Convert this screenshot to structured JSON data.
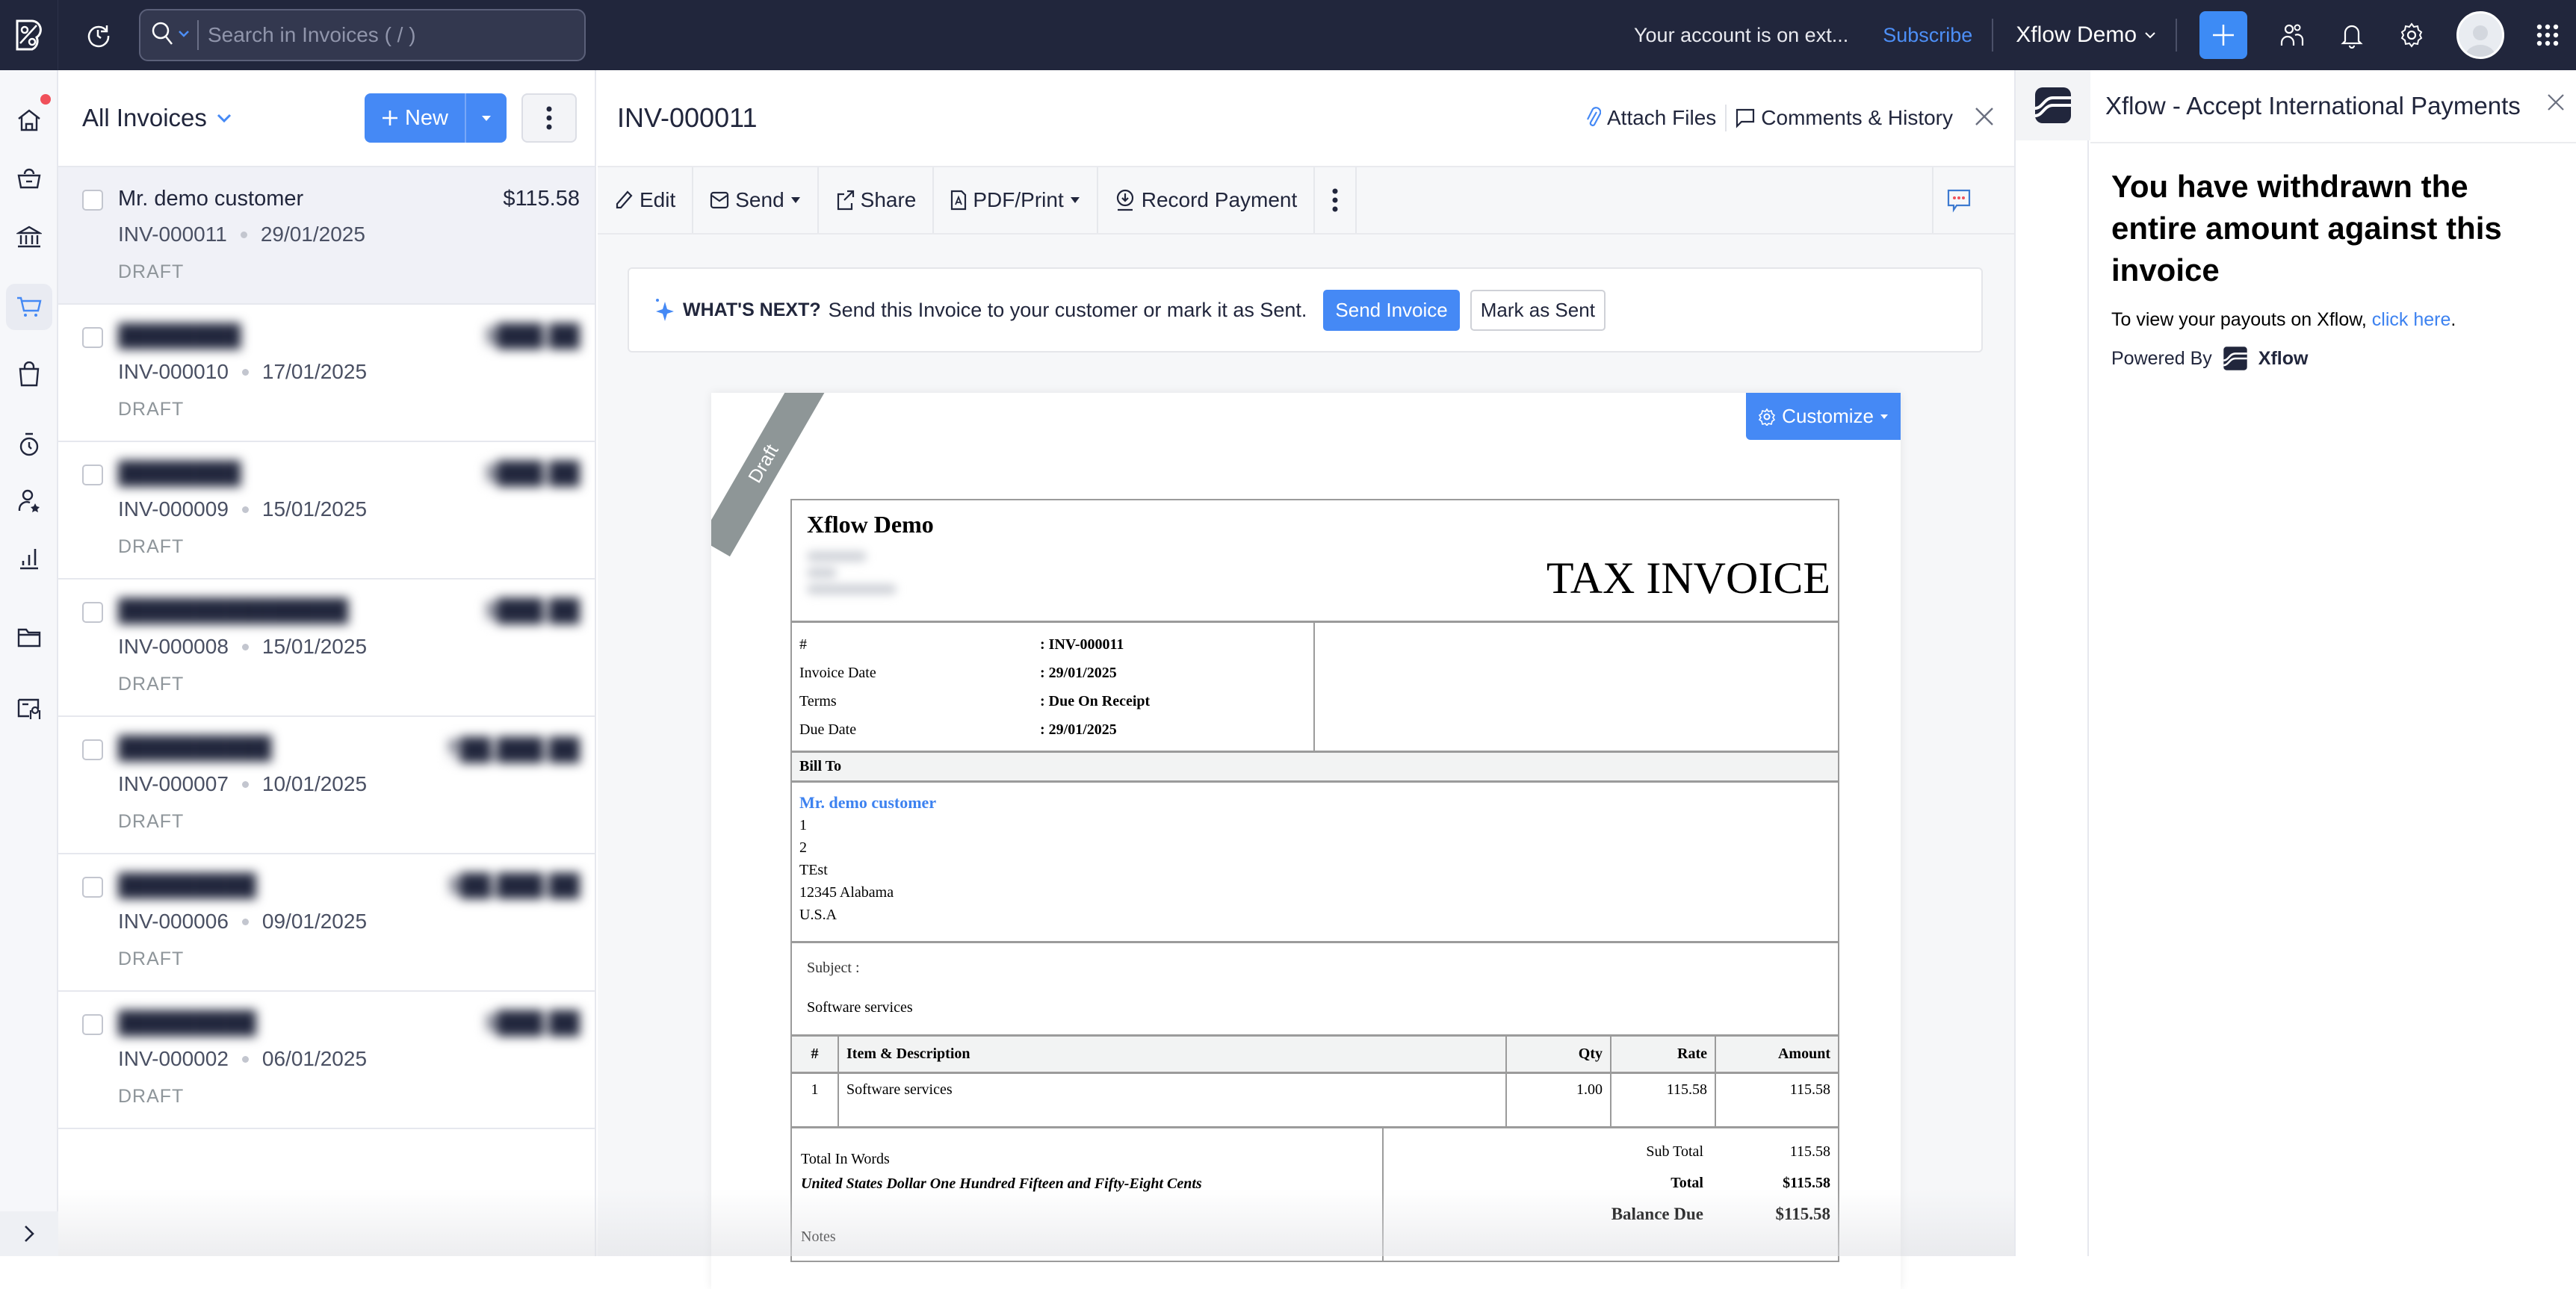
{
  "topbar": {
    "search_placeholder": "Search in Invoices ( / )",
    "account_notice": "Your account is on ext...",
    "subscribe_label": "Subscribe",
    "org_name": "Xflow Demo"
  },
  "sidebar": {
    "items": [
      "home-icon",
      "items-basket-icon",
      "banking-icon",
      "sales-cart-icon",
      "purchases-bag-icon",
      "time-tracking-icon",
      "accountant-icon",
      "reports-icon",
      "documents-folder-icon",
      "more-apps-icon"
    ],
    "active": "sales-cart-icon"
  },
  "list": {
    "title": "All Invoices",
    "new_label": "New",
    "rows": [
      {
        "name": "Mr. demo customer",
        "amount": "$115.58",
        "number": "INV-000011",
        "date": "29/01/2025",
        "status": "DRAFT",
        "blurred": false,
        "selected": true
      },
      {
        "name": "████████",
        "amount": "$███.██",
        "number": "INV-000010",
        "date": "17/01/2025",
        "status": "DRAFT",
        "blurred": true
      },
      {
        "name": "████████",
        "amount": "$███.██",
        "number": "INV-000009",
        "date": "15/01/2025",
        "status": "DRAFT",
        "blurred": true
      },
      {
        "name": "███████████████",
        "amount": "$███.██",
        "number": "INV-000008",
        "date": "15/01/2025",
        "status": "DRAFT",
        "blurred": true
      },
      {
        "name": "██████████",
        "amount": "₹██,███.██",
        "number": "INV-000007",
        "date": "10/01/2025",
        "status": "DRAFT",
        "blurred": true
      },
      {
        "name": "█████████",
        "amount": "$██,███.██",
        "number": "INV-000006",
        "date": "09/01/2025",
        "status": "DRAFT",
        "blurred": true
      },
      {
        "name": "█████████",
        "amount": "$███.██",
        "number": "INV-000002",
        "date": "06/01/2025",
        "status": "DRAFT",
        "blurred": true
      }
    ]
  },
  "detail": {
    "title": "INV-000011",
    "attach_label": "Attach Files",
    "comments_label": "Comments & History",
    "toolbar": {
      "edit": "Edit",
      "send": "Send",
      "share": "Share",
      "pdf": "PDF/Print",
      "record": "Record Payment"
    },
    "whats_next": {
      "label": "WHAT'S NEXT?",
      "text": "Send this Invoice to your customer or mark it as Sent.",
      "send_button": "Send Invoice",
      "mark_button": "Mark as Sent"
    }
  },
  "invoice": {
    "ribbon": "Draft",
    "customize_label": "Customize",
    "org_name": "Xflow Demo",
    "doc_title": "TAX INVOICE",
    "meta": [
      {
        "key": "#",
        "value": ": INV-000011"
      },
      {
        "key": "Invoice Date",
        "value": ": 29/01/2025"
      },
      {
        "key": "Terms",
        "value": ": Due On Receipt"
      },
      {
        "key": "Due Date",
        "value": ": 29/01/2025"
      }
    ],
    "bill_to_label": "Bill To",
    "customer": "Mr. demo customer",
    "address": [
      "1",
      "2",
      "TEst",
      "12345 Alabama",
      "U.S.A"
    ],
    "subject_label": "Subject :",
    "subject": "Software services",
    "columns": [
      "#",
      "Item & Description",
      "Qty",
      "Rate",
      "Amount"
    ],
    "items": [
      {
        "n": "1",
        "desc": "Software services",
        "qty": "1.00",
        "rate": "115.58",
        "amount": "115.58"
      }
    ],
    "total_words_label": "Total In Words",
    "total_words": "United States Dollar One Hundred Fifteen and Fifty-Eight Cents",
    "notes_label": "Notes",
    "sub_total_label": "Sub Total",
    "sub_total": "115.58",
    "total_label": "Total",
    "total": "$115.58",
    "balance_label": "Balance Due",
    "balance": "$115.58"
  },
  "xflow": {
    "title": "Xflow - Accept International Payments",
    "headline": "You have withdrawn the entire amount against this invoice",
    "payout_text": "To view your payouts on Xflow, ",
    "payout_link": "click here",
    "payout_end": ".",
    "powered_by": "Powered By",
    "brand": "Xflow"
  },
  "colors": {
    "accent": "#4589f5",
    "topbar": "#21263c",
    "draft_ribbon": "#8e9697",
    "link": "#3d82f0"
  }
}
